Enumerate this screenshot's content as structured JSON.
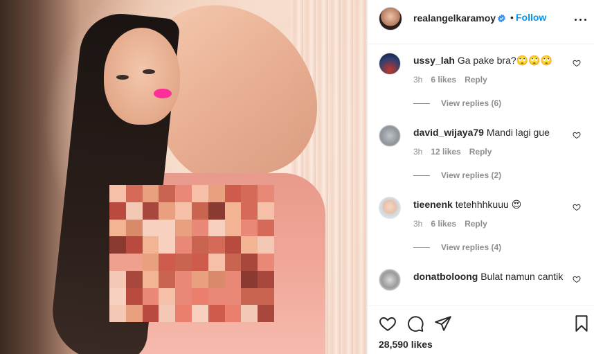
{
  "post": {
    "username": "realangelkaramoy",
    "separator": "•",
    "follow_label": "Follow"
  },
  "comments": [
    {
      "user": "ussy_lah",
      "text": "Ga pake bra?🙄🙄🙄",
      "time": "3h",
      "likes": "6 likes",
      "reply": "Reply",
      "view_replies": "View replies (6)"
    },
    {
      "user": "david_wijaya79",
      "text": "Mandi lagi gue",
      "time": "3h",
      "likes": "12 likes",
      "reply": "Reply",
      "view_replies": "View replies (2)"
    },
    {
      "user": "tieenenk",
      "text": "tetehhhkuuu 😍",
      "time": "3h",
      "likes": "6 likes",
      "reply": "Reply",
      "view_replies": "View replies (4)"
    },
    {
      "user": "donatboloong",
      "text": "Bulat namun cantik"
    }
  ],
  "footer": {
    "likes_total": "28,590 likes"
  },
  "colors": {
    "follow": "#0095f6",
    "text": "#262626",
    "muted": "#8e8e8e",
    "lips": "#ff2f9a"
  },
  "icons": {
    "like": "heart-icon",
    "comment": "comment-bubble-icon",
    "share": "paper-plane-icon",
    "save": "bookmark-icon",
    "more": "more-options-icon",
    "verified": "verified-badge-icon"
  }
}
